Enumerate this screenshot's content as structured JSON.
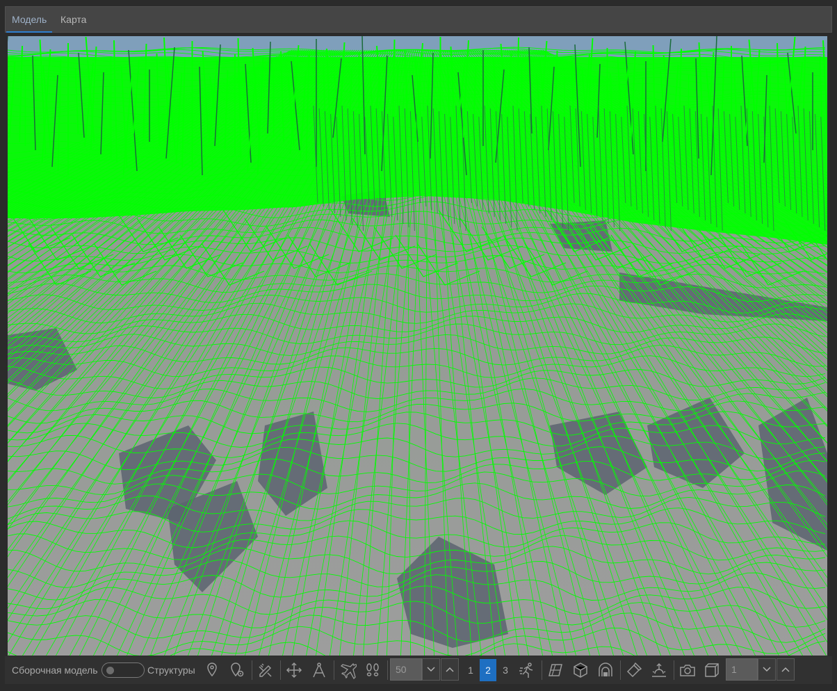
{
  "tabs": [
    {
      "label": "Модель",
      "active": true
    },
    {
      "label": "Карта",
      "active": false
    }
  ],
  "viewport": {
    "render_mode": "wireframe",
    "sky_color": "#7f9fbb",
    "surface_color": "#9a9a9a",
    "wire_color": "#00ff00",
    "shadow_color": "#5c6470"
  },
  "toolbar": {
    "assembly_label": "Сборочная модель",
    "assembly_toggle_on": false,
    "structures_label": "Структуры",
    "icons": [
      "map-pin-icon",
      "pin-settings-icon",
      "pencil-ruler-icon",
      "move-arrows-icon",
      "compass-measure-icon",
      "airplane-icon",
      "footprints-icon",
      "run-icon",
      "plane-section-icon",
      "cube-view-icon",
      "arch-cut-icon",
      "flashlight-icon",
      "sun-horizon-icon",
      "camera-icon",
      "box-outline-icon"
    ],
    "speed_value": "50",
    "pages": [
      "1",
      "2",
      "3"
    ],
    "active_page": "2",
    "layer_value": "1"
  }
}
